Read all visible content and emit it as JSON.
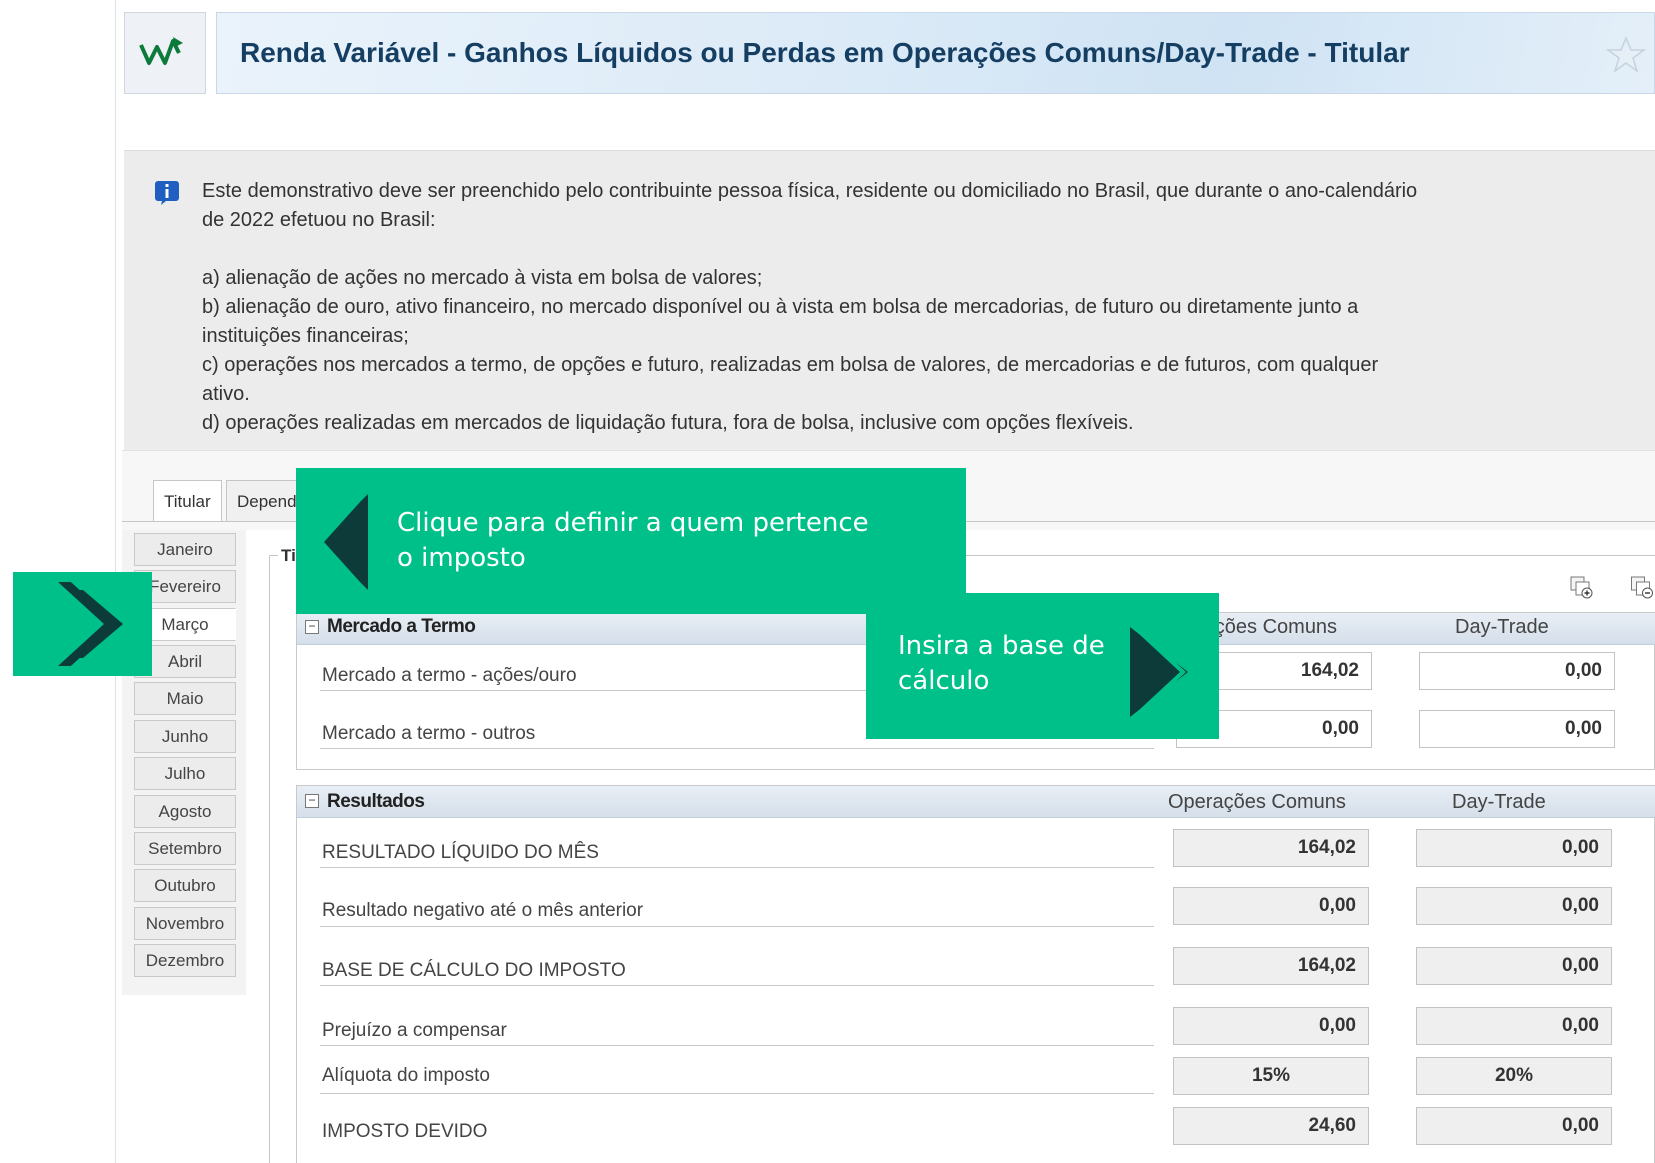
{
  "header": {
    "title": "Renda Variável - Ganhos Líquidos ou Perdas em Operações Comuns/Day-Trade - Titular"
  },
  "info": {
    "intro_line1": "Este demonstrativo deve ser preenchido pelo contribuinte pessoa física, residente ou domiciliado no Brasil, que durante o ano-calendário",
    "intro_line2": "de 2022 efetuou no Brasil:",
    "item_a": "a) alienação de ações no mercado à vista em bolsa de valores;",
    "item_b1": "b) alienação de ouro, ativo financeiro, no mercado disponível ou à vista em bolsa de mercadorias, de futuro ou diretamente junto a",
    "item_b2": "instituições financeiras;",
    "item_c1": "c) operações nos mercados a termo, de opções e futuro, realizadas em bolsa de valores, de mercadorias e de futuros, com qualquer",
    "item_c2": "ativo.",
    "item_d": "d) operações realizadas em mercados de liquidação futura, fora de bolsa, inclusive com opções flexíveis."
  },
  "tabs": {
    "titular": "Titular",
    "dependentes": "Depend"
  },
  "months": [
    "Janeiro",
    "Fevereiro",
    "Março",
    "Abril",
    "Maio",
    "Junho",
    "Julho",
    "Agosto",
    "Setembro",
    "Outubro",
    "Novembro",
    "Dezembro"
  ],
  "active_month": "Março",
  "frame_title": "Ti",
  "termo": {
    "title": "Mercado a Termo",
    "col_comuns": "rações Comuns",
    "col_daytrade": "Day-Trade",
    "rows": [
      {
        "label": "Mercado a termo - ações/ouro",
        "comuns": "164,02",
        "daytrade": "0,00"
      },
      {
        "label": "Mercado a termo - outros",
        "comuns": "0,00",
        "daytrade": "0,00"
      }
    ]
  },
  "resultados": {
    "title": "Resultados",
    "col_comuns": "Operações Comuns",
    "col_daytrade": "Day-Trade",
    "rows": [
      {
        "label": "RESULTADO LÍQUIDO DO MÊS",
        "comuns": "164,02",
        "daytrade": "0,00"
      },
      {
        "label": "Resultado negativo até o mês anterior",
        "comuns": "0,00",
        "daytrade": "0,00"
      },
      {
        "label": "BASE DE CÁLCULO DO IMPOSTO",
        "comuns": "164,02",
        "daytrade": "0,00"
      },
      {
        "label": "Prejuízo a compensar",
        "comuns": "0,00",
        "daytrade": "0,00"
      },
      {
        "label": "Alíquota do imposto",
        "comuns": "15%",
        "daytrade": "20%"
      },
      {
        "label": "IMPOSTO DEVIDO",
        "comuns": "24,60",
        "daytrade": "0,00"
      }
    ]
  },
  "callouts": {
    "tab_hint_line1": "Clique para definir a quem pertence",
    "tab_hint_line2": "o imposto",
    "base_hint_line1": "Insira a base de",
    "base_hint_line2": "cálculo"
  },
  "colors": {
    "callout_green": "#00c08a",
    "callout_chevron": "#0d3b3a",
    "title_blue": "#153e63"
  }
}
